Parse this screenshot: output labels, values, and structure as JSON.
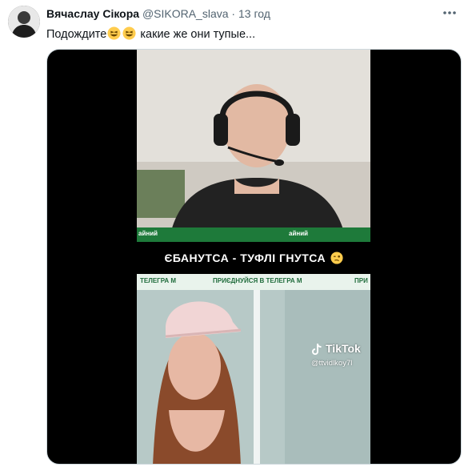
{
  "tweet": {
    "display_name": "Вячаслау Сікора",
    "handle": "@SIKORA_slava",
    "separator": "·",
    "time": "13 год",
    "text_part1": "Подождите",
    "text_part2": " какие же они тупые..."
  },
  "media": {
    "caption": "ЄБАНУТСА - ТУФЛІ ГНУТСА",
    "lower_third_left": "айний",
    "lower_third_right": "айний",
    "promo_left": "ТЕЛЕГРА М",
    "promo_mid": "ПРИЄДНУЙСЯ В ТЕЛЕГРА М",
    "promo_right": "ПРИ",
    "tiktok_label": "TikTok",
    "tiktok_user": "@ttvidlkoy7l"
  },
  "icons": {
    "emoji": "grinning-squinting-face",
    "caption_emoji": "woozy-face",
    "more": "more-horizontal-icon",
    "tiktok": "tiktok-logo"
  },
  "colors": {
    "text": "#0f1419",
    "secondary": "#536471",
    "media_bg": "#000000",
    "lower_third_green": "#1e7a3a"
  }
}
